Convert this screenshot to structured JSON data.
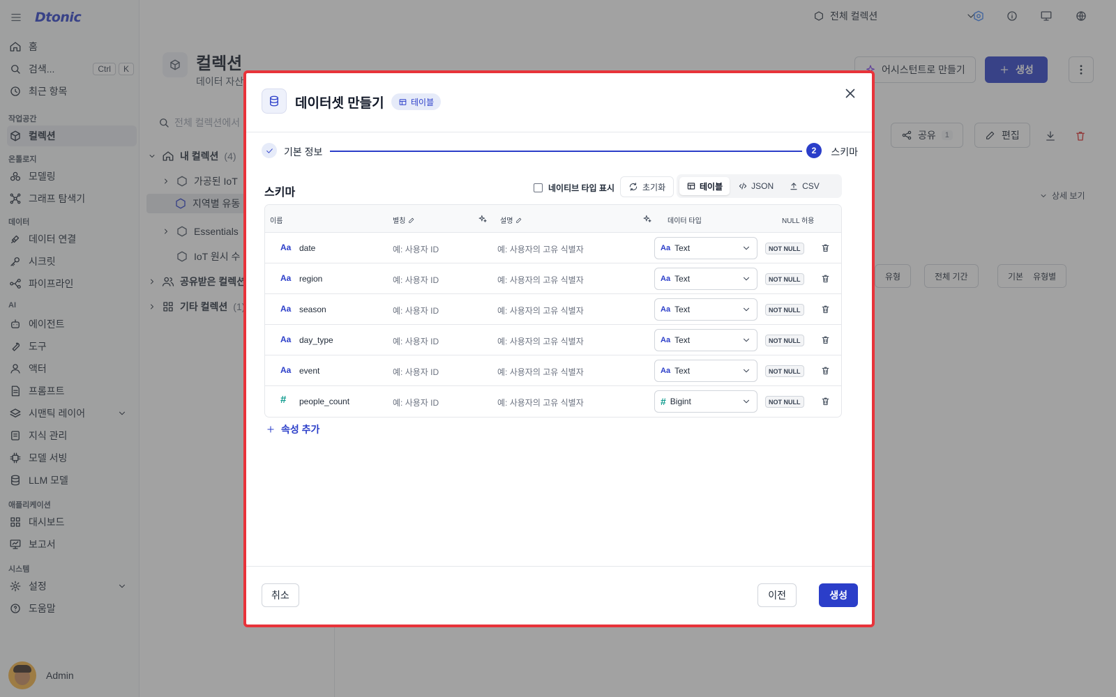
{
  "app": {
    "logo": "Dtonic"
  },
  "topbar": {
    "collection_scope": "전체 컬렉션"
  },
  "sidebar": {
    "home": "홈",
    "search": {
      "label": "검색...",
      "kbd1": "Ctrl",
      "kbd2": "K"
    },
    "recent": "최근 항목",
    "sections": {
      "workspace": "작업공간",
      "ontology": "온톨로지",
      "data": "데이터",
      "ai": "AI",
      "application": "애플리케이션",
      "system": "시스템"
    },
    "items": {
      "collection": "컬렉션",
      "modeling": "모델링",
      "graph": "그래프 탐색기",
      "data_connect": "데이터 연결",
      "secret": "시크릿",
      "pipeline": "파이프라인",
      "agent": "에이전트",
      "tool": "도구",
      "actor": "액터",
      "prompt": "프롬프트",
      "semantic": "시맨틱 레이어",
      "knowledge": "지식 관리",
      "model_serving": "모델 서빙",
      "llm": "LLM 모델",
      "dashboard": "대시보드",
      "report": "보고서",
      "settings": "설정",
      "help": "도움말"
    },
    "user": "Admin"
  },
  "page": {
    "title": "컬렉션",
    "subtitle": "데이터 자산",
    "assistant_button": "어시스턴트로 만들기",
    "create_button": "생성",
    "search_placeholder": "전체 컬렉션에서",
    "share": "공유",
    "share_count": "1",
    "edit": "편집",
    "detail_view": "상세 보기",
    "filter_type": "유형",
    "filter_period": "전체 기간",
    "view_basic": "기본",
    "view_by_type": "유형별"
  },
  "tree": {
    "my_collections": "내 컬렉션",
    "my_count": "(4)",
    "item1": "가공된 IoT",
    "item2": "지역별 유동",
    "item3": "Essentials",
    "item4": "IoT 원시 수",
    "shared": "공유받은 컬렉션",
    "other": "기타 컬렉션",
    "other_count": "(1)"
  },
  "modal": {
    "title": "데이터셋 만들기",
    "badge": "테이블",
    "step1": "기본 정보",
    "step2_num": "2",
    "step2": "스키마",
    "schema_title": "스키마",
    "native_type_label": "네이티브 타입 표시",
    "reset": "초기화",
    "views": {
      "table": "테이블",
      "json": "JSON",
      "csv": "CSV"
    },
    "columns": {
      "name": "이름",
      "alias": "별칭",
      "desc": "설명",
      "dtype": "데이터 타입",
      "nullable": "NULL 허용"
    },
    "rows": [
      {
        "name": "date",
        "alias_ph": "예: 사용자 ID",
        "desc_ph": "예: 사용자의 고유 식별자",
        "type": "Text",
        "type_icon": "Aa",
        "null": "NOT NULL"
      },
      {
        "name": "region",
        "alias_ph": "예: 사용자 ID",
        "desc_ph": "예: 사용자의 고유 식별자",
        "type": "Text",
        "type_icon": "Aa",
        "null": "NOT NULL"
      },
      {
        "name": "season",
        "alias_ph": "예: 사용자 ID",
        "desc_ph": "예: 사용자의 고유 식별자",
        "type": "Text",
        "type_icon": "Aa",
        "null": "NOT NULL"
      },
      {
        "name": "day_type",
        "alias_ph": "예: 사용자 ID",
        "desc_ph": "예: 사용자의 고유 식별자",
        "type": "Text",
        "type_icon": "Aa",
        "null": "NOT NULL"
      },
      {
        "name": "event",
        "alias_ph": "예: 사용자 ID",
        "desc_ph": "예: 사용자의 고유 식별자",
        "type": "Text",
        "type_icon": "Aa",
        "null": "NOT NULL"
      },
      {
        "name": "people_count",
        "alias_ph": "예: 사용자 ID",
        "desc_ph": "예: 사용자의 고유 식별자",
        "type": "Bigint",
        "type_icon": "#",
        "null": "NOT NULL"
      }
    ],
    "add_property": "속성 추가",
    "cancel": "취소",
    "prev": "이전",
    "create": "생성"
  },
  "colors": {
    "primary": "#2b3ec9",
    "highlight_border": "#e8333a",
    "numeric_type": "#0f9b8e"
  }
}
